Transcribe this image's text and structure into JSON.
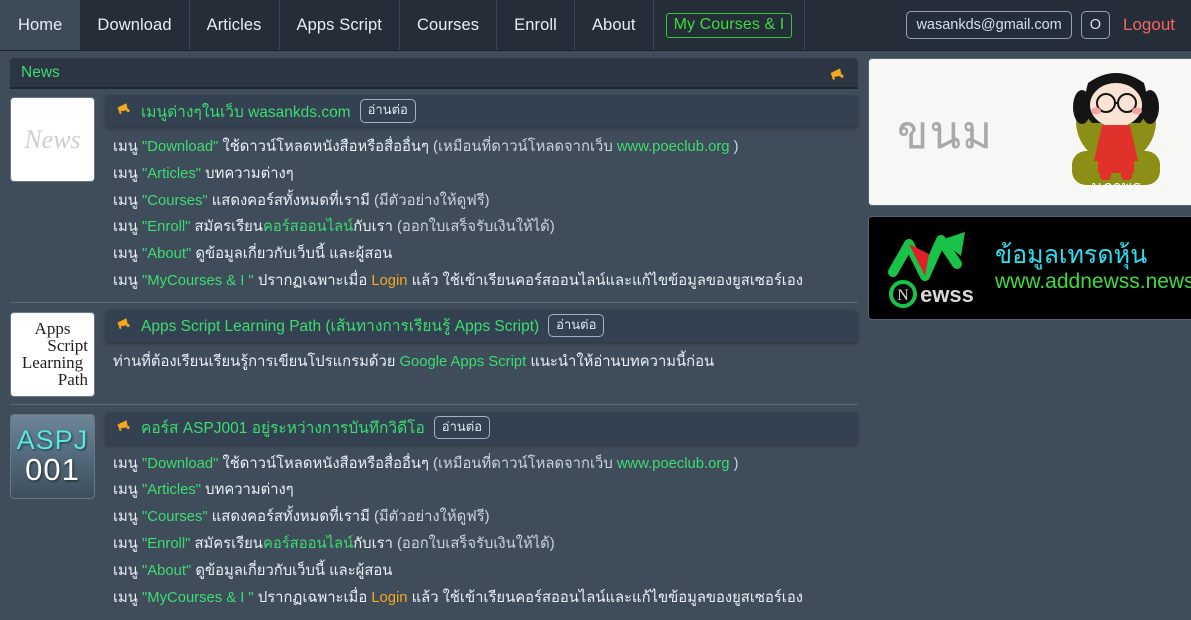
{
  "nav": {
    "tabs": [
      {
        "label": "Home",
        "active": true,
        "boxed": false
      },
      {
        "label": "Download",
        "active": false,
        "boxed": false
      },
      {
        "label": "Articles",
        "active": false,
        "boxed": false
      },
      {
        "label": "Apps Script",
        "active": false,
        "boxed": false
      },
      {
        "label": "Courses",
        "active": false,
        "boxed": false
      },
      {
        "label": "Enroll",
        "active": false,
        "boxed": false
      },
      {
        "label": "About",
        "active": false,
        "boxed": false
      },
      {
        "label": "My Courses & I",
        "active": false,
        "boxed": true
      }
    ],
    "account": {
      "email": "wasankds@gmail.com",
      "avatar_letter": "O",
      "logout_label": "Logout"
    }
  },
  "panel": {
    "title": "News",
    "bell_icon": "megaphone-icon"
  },
  "articles": [
    {
      "thumb_kind": "news",
      "thumb_text": "News",
      "icon": "megaphone-icon",
      "title": "เมนูต่างๆในเว็บ wasankds.com",
      "readmore_label": "อ่านต่อ",
      "lines": [
        {
          "segments": [
            {
              "t": "เมนู ",
              "c": "w"
            },
            {
              "t": "\"Download\"",
              "c": "g"
            },
            {
              "t": " ใช้ดาวน์โหลดหนังสือหรือสื่ออื่นๆ ",
              "c": "w"
            },
            {
              "t": "(เหมือนที่ดาวน์โหลดจากเว็บ ",
              "c": "d"
            },
            {
              "t": "www.poeclub.org",
              "c": "g"
            },
            {
              "t": " )",
              "c": "d"
            }
          ]
        },
        {
          "segments": [
            {
              "t": "เมนู ",
              "c": "w"
            },
            {
              "t": "\"Articles\"",
              "c": "g"
            },
            {
              "t": " บทความต่างๆ",
              "c": "w"
            }
          ]
        },
        {
          "segments": [
            {
              "t": "เมนู ",
              "c": "w"
            },
            {
              "t": "\"Courses\"",
              "c": "g"
            },
            {
              "t": " แสดงคอร์สทั้งหมดที่เรามี ",
              "c": "w"
            },
            {
              "t": "(มีตัวอย่างให้ดูฟรี)",
              "c": "d"
            }
          ]
        },
        {
          "segments": [
            {
              "t": "เมนู ",
              "c": "w"
            },
            {
              "t": "\"Enroll\"",
              "c": "g"
            },
            {
              "t": " สมัครเรียน",
              "c": "w"
            },
            {
              "t": "คอร์สออนไลน์",
              "c": "g"
            },
            {
              "t": "กับเรา ",
              "c": "w"
            },
            {
              "t": "(ออกใบเสร็จรับเงินให้ได้)",
              "c": "d"
            }
          ]
        },
        {
          "segments": [
            {
              "t": "เมนู ",
              "c": "w"
            },
            {
              "t": "\"About\"",
              "c": "g"
            },
            {
              "t": " ดูข้อมูลเกี่ยวกับเว็บนี้ และผู้สอน",
              "c": "w"
            }
          ]
        },
        {
          "segments": [
            {
              "t": "เมนู ",
              "c": "w"
            },
            {
              "t": "\"MyCourses & I \"",
              "c": "g"
            },
            {
              "t": " ปรากฏเฉพาะเมื่อ ",
              "c": "w"
            },
            {
              "t": "Login",
              "c": "o"
            },
            {
              "t": " แล้ว ใช้เข้าเรียนคอร์สออนไลน์และแก้ไขข้อมูลของยูสเซอร์เอง",
              "c": "w"
            }
          ]
        }
      ]
    },
    {
      "thumb_kind": "apps-script-path",
      "thumb_lines": [
        "Apps",
        "Script",
        "Learning",
        "Path"
      ],
      "icon": "megaphone-icon",
      "title": "Apps Script Learning Path (เส้นทางการเรียนรู้ Apps Script)",
      "readmore_label": "อ่านต่อ",
      "lines": [
        {
          "segments": [
            {
              "t": "ท่านที่ต้องเรียนเรียนรู้การเขียนโปรแกรมด้วย ",
              "c": "w"
            },
            {
              "t": "Google Apps Script",
              "c": "g"
            },
            {
              "t": " แนะนำให้อ่านบทความนี้ก่อน",
              "c": "w"
            }
          ]
        }
      ]
    },
    {
      "thumb_kind": "aspj001",
      "thumb_line1": "ASPJ",
      "thumb_line2": "001",
      "icon": "megaphone-icon",
      "title": "คอร์ส ASPJ001 อยู่ระหว่างการบันทึกวิดีโอ",
      "readmore_label": "อ่านต่อ",
      "lines": [
        {
          "segments": [
            {
              "t": "เมนู ",
              "c": "w"
            },
            {
              "t": "\"Download\"",
              "c": "g"
            },
            {
              "t": " ใช้ดาวน์โหลดหนังสือหรือสื่ออื่นๆ ",
              "c": "w"
            },
            {
              "t": "(เหมือนที่ดาวน์โหลดจากเว็บ ",
              "c": "d"
            },
            {
              "t": "www.poeclub.org",
              "c": "g"
            },
            {
              "t": " )",
              "c": "d"
            }
          ]
        },
        {
          "segments": [
            {
              "t": "เมนู ",
              "c": "w"
            },
            {
              "t": "\"Articles\"",
              "c": "g"
            },
            {
              "t": " บทความต่างๆ",
              "c": "w"
            }
          ]
        },
        {
          "segments": [
            {
              "t": "เมนู ",
              "c": "w"
            },
            {
              "t": "\"Courses\"",
              "c": "g"
            },
            {
              "t": " แสดงคอร์สทั้งหมดที่เรามี ",
              "c": "w"
            },
            {
              "t": "(มีตัวอย่างให้ดูฟรี)",
              "c": "d"
            }
          ]
        },
        {
          "segments": [
            {
              "t": "เมนู ",
              "c": "w"
            },
            {
              "t": "\"Enroll\"",
              "c": "g"
            },
            {
              "t": " สมัครเรียน",
              "c": "w"
            },
            {
              "t": "คอร์สออนไลน์",
              "c": "g"
            },
            {
              "t": "กับเรา ",
              "c": "w"
            },
            {
              "t": "(ออกใบเสร็จรับเงินให้ได้)",
              "c": "d"
            }
          ]
        },
        {
          "segments": [
            {
              "t": "เมนู ",
              "c": "w"
            },
            {
              "t": "\"About\"",
              "c": "g"
            },
            {
              "t": " ดูข้อมูลเกี่ยวกับเว็บนี้ และผู้สอน",
              "c": "w"
            }
          ]
        },
        {
          "segments": [
            {
              "t": "เมนู ",
              "c": "w"
            },
            {
              "t": "\"MyCourses & I \"",
              "c": "g"
            },
            {
              "t": " ปรากฏเฉพาะเมื่อ ",
              "c": "w"
            },
            {
              "t": "Login",
              "c": "o"
            },
            {
              "t": " แล้ว ใช้เข้าเรียนคอร์สออนไลน์และแก้ไขข้อมูลของยูสเซอร์เอง",
              "c": "w"
            }
          ]
        }
      ]
    }
  ],
  "sidebar": {
    "ads": [
      {
        "kind": "kanom",
        "word": "ขนม",
        "mascot_label": "นภาพร",
        "mascot_icon": "girl-mascot-icon"
      },
      {
        "kind": "newss",
        "logo_icon": "newss-arrow-logo-icon",
        "logo_text": "Newss",
        "headline": "ข้อมูลเทรดหุ้น",
        "url": "www.addnewss.news"
      }
    ]
  },
  "colors": {
    "accent_green": "#3ddc72",
    "accent_orange": "#f5a623",
    "logout_red": "#f4655f",
    "topbar_bg": "#252d38",
    "page_bg": "#3f4c59",
    "panel_bg": "#334150"
  }
}
